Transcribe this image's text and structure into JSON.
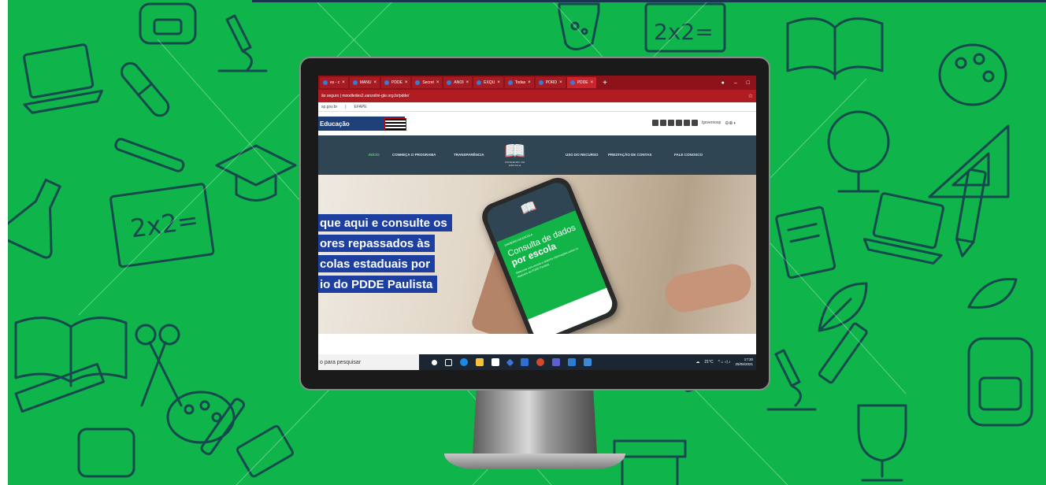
{
  "background": {
    "color": "#0fb54a",
    "doodle_color": "#17364e"
  },
  "browser": {
    "tabs": [
      {
        "label": "es - c",
        "icon": "page-icon",
        "active": false
      },
      {
        "label": "MANU",
        "icon": "doc-icon",
        "active": false
      },
      {
        "label": "PDDE",
        "icon": "doc-icon",
        "active": false
      },
      {
        "label": "Secret",
        "icon": "site-icon",
        "active": false
      },
      {
        "label": "ANOI",
        "icon": "site-icon",
        "active": false
      },
      {
        "label": "EXQU",
        "icon": "site-icon",
        "active": false
      },
      {
        "label": "Todas",
        "icon": "site-icon",
        "active": false
      },
      {
        "label": "PORD",
        "icon": "site-icon",
        "active": false
      },
      {
        "label": "PDDE",
        "icon": "site-icon",
        "active": true
      }
    ],
    "new_tab": "+",
    "address": "ão seguro | moodledes2.vanzolini-gte.org.br/pdde/",
    "bookmarks": [
      "sp.gov.br",
      "|",
      "EFAPE"
    ]
  },
  "site": {
    "gov_label": "Educação",
    "social_handle": "/governosp",
    "nav": {
      "items": [
        {
          "label": "INÍCIO",
          "active": true
        },
        {
          "label": "CONHEÇA O PROGRAMA",
          "active": false
        },
        {
          "label": "TRANSPARÊNCIA",
          "active": false
        },
        {
          "label": "USO DO RECURSO",
          "active": false
        },
        {
          "label": "PRESTAÇÃO DE CONTAS",
          "active": false
        },
        {
          "label": "FALE CONOSCO",
          "active": false
        }
      ],
      "logo_caption": "DINHEIRO NA ESCOLA"
    },
    "hero": {
      "lines": [
        "que aqui e consulte os",
        "ores repassados às",
        "colas estaduais por",
        "io do PDDE Paulista"
      ]
    },
    "phone": {
      "small_label": "DINHEIRO NA ESCOLA",
      "title": "Consulta de dados",
      "title_bold": "por escola",
      "text": "Selecione uma escola e obtenha informações sobre os repasses do PDDE Paulista."
    }
  },
  "taskbar": {
    "search_placeholder": "o para pesquisar",
    "temperature": "21°C",
    "time": "17:30",
    "date": "25/06/2021"
  }
}
